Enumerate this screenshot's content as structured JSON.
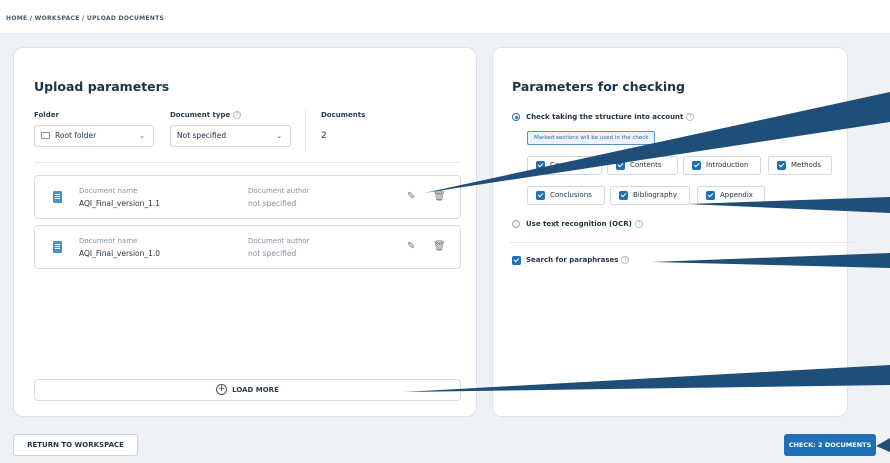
{
  "breadcrumb": "HOME / WORKSPACE / UPLOAD DOCUMENTS",
  "upload": {
    "title": "Upload parameters",
    "folder_label": "Folder",
    "folder_value": "Root folder",
    "doctype_label": "Document type",
    "doctype_value": "Not specified",
    "documents_label": "Documents",
    "documents_count": "2",
    "name_label": "Document name",
    "author_label": "Document author",
    "docs": [
      {
        "name": "AQI_Final_version_1.1",
        "author": "not specified"
      },
      {
        "name": "AQI_Final_version_1.0",
        "author": "not specified"
      }
    ],
    "load_more": "LOAD MORE"
  },
  "checking": {
    "title": "Parameters for checking",
    "opt_structure": "Check taking the structure into account",
    "hint": "Marked sections will be used in the check",
    "sections": [
      "Cover",
      "Contents",
      "Introduction",
      "Methods",
      "Conclusions",
      "Bibliography",
      "Appendix"
    ],
    "opt_ocr": "Use text recognition (OCR)",
    "opt_paraphrase": "Search for paraphrases"
  },
  "footer": {
    "return_label": "RETURN TO WORKSPACE",
    "check_label": "CHECK: 2 DOCUMENTS"
  },
  "colors": {
    "accent": "#1e6fb4",
    "arrow": "#1f4e79"
  },
  "icons": [
    "help-icon",
    "folder-icon",
    "chevron-down-icon",
    "document-icon",
    "pencil-icon",
    "trash-icon",
    "plus-circle-icon",
    "checkbox-icon",
    "radio-icon"
  ]
}
